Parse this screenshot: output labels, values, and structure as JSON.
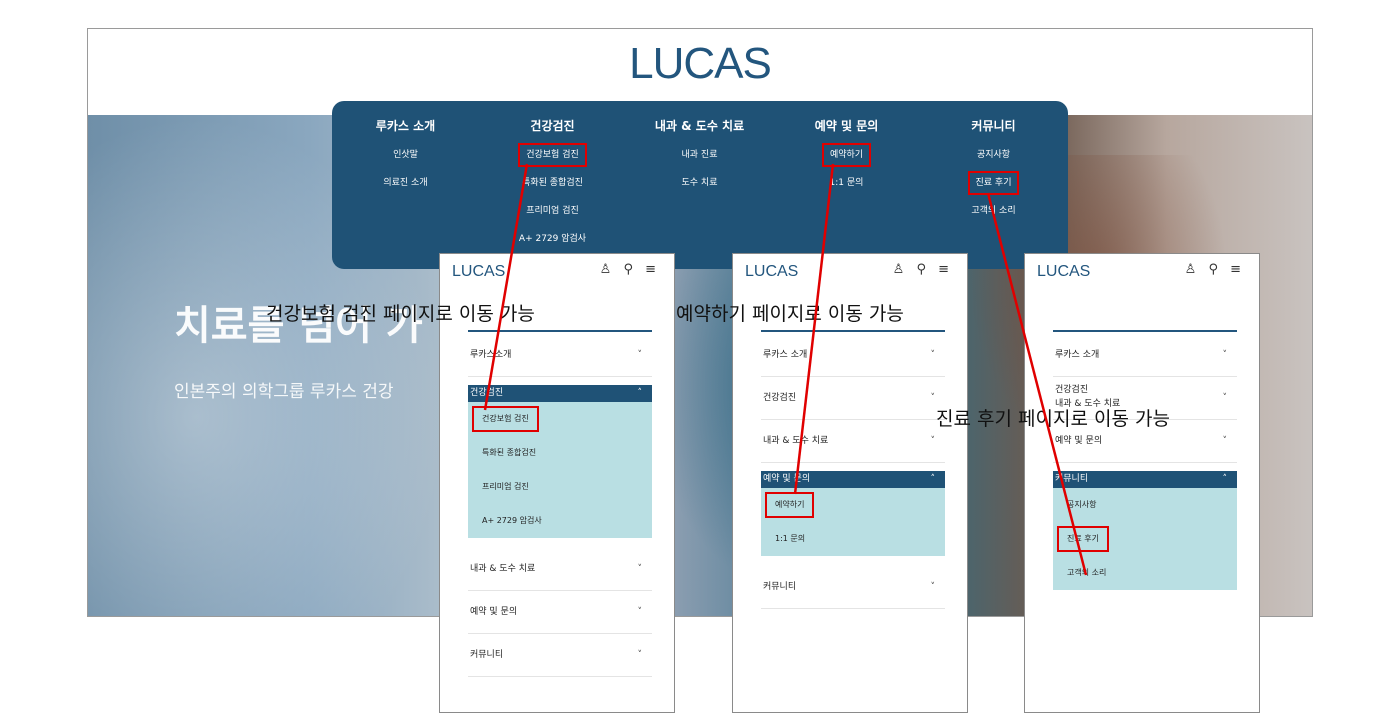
{
  "site": {
    "logo": "LUCAS"
  },
  "hero": {
    "title": "치료를 넘어 가",
    "subtitle": "인본주의 의학그룹 루카스 건강"
  },
  "mega_menu": [
    {
      "heading": "루카스 소개",
      "items": [
        "인삿말",
        "의료진 소개"
      ]
    },
    {
      "heading": "건강검진",
      "items": [
        "건강보험 검진",
        "특화된 종합검진",
        "프리미엄 검진",
        "A+ 2729 암검사"
      ]
    },
    {
      "heading": "내과 & 도수 치료",
      "items": [
        "내과 진료",
        "도수 치료"
      ]
    },
    {
      "heading": "예약 및 문의",
      "items": [
        "예약하기",
        "1:1 문의"
      ]
    },
    {
      "heading": "커뮤니티",
      "items": [
        "공지사항",
        "진료 후기",
        "고객의 소리"
      ]
    }
  ],
  "phone1": {
    "logo": "LUCAS",
    "icons": "♙ ⚲ ≡",
    "row_top": "루카스소개",
    "open_head": "건강검진",
    "sub_items": [
      "건강보험 검진",
      "특화된 종합검진",
      "프리미엄 검진",
      "A+ 2729 암검사"
    ],
    "rows_bottom": [
      "내과 & 도수 치료",
      "예약 및 문의",
      "커뮤니티"
    ]
  },
  "phone2": {
    "logo": "LUCAS",
    "icons": "♙ ⚲ ≡",
    "rows_top": [
      "루카스 소개",
      "건강검진",
      "내과 & 도수 치료"
    ],
    "open_head": "예약 및 문의",
    "sub_items": [
      "예약하기",
      "1:1 문의"
    ],
    "rows_bottom": [
      "커뮤니티"
    ]
  },
  "phone3": {
    "logo": "LUCAS",
    "icons": "♙ ⚲ ≡",
    "rows_top": [
      "루카스 소개",
      "건강검진",
      "예약 및 문의"
    ],
    "row_overlap": "내과 & 도수 치료",
    "open_head": "커뮤니티",
    "sub_items": [
      "공지사항",
      "진료 후기",
      "고객의 소리"
    ]
  },
  "annotations": {
    "a1": "건강보험 검진 페이지로 이동 가능",
    "a2": "예약하기 페이지로 이동 가능",
    "a3": "진료 후기 페이지로 이동 가능"
  },
  "chevrons": {
    "down": "˅",
    "up": "˄"
  },
  "colors": {
    "brand_navy": "#1f5276",
    "submenu_bg": "#b9dfe3",
    "highlight": "#e00000"
  }
}
